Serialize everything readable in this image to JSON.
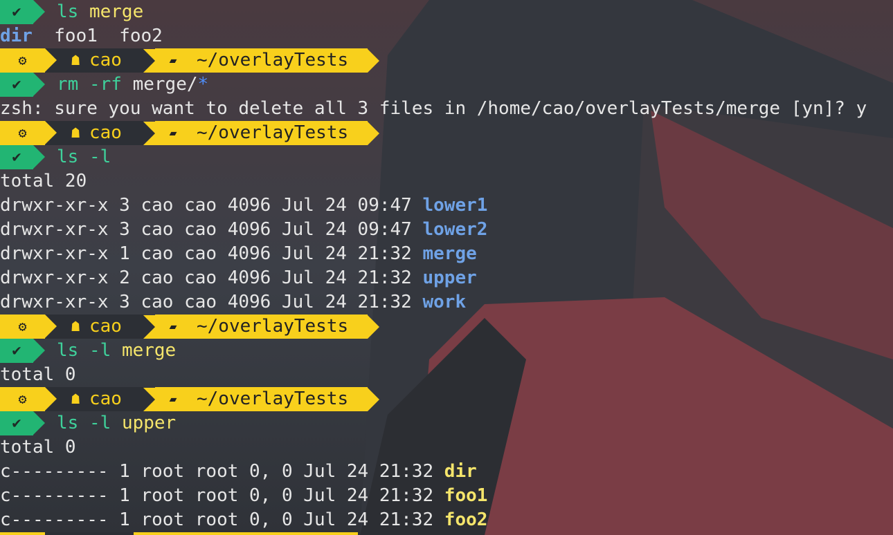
{
  "prompt": {
    "os_icon": "ubuntu-icon",
    "user_icon": "user-icon",
    "user": "cao",
    "folder_icon": "folder-icon",
    "dir": "~/overlayTests",
    "colors": {
      "accent": "#f8d01c",
      "ok": "#22b573",
      "segment_dark": "#2c2f35"
    }
  },
  "status_icon": "check-icon",
  "lines": {
    "l1": {
      "cmd": "ls",
      "arg": "merge"
    },
    "l2": {
      "items": [
        "dir",
        "foo1",
        "foo2"
      ]
    },
    "l4": {
      "cmd": "rm",
      "flag": "-rf",
      "arg": "merge/",
      "glob": "*"
    },
    "l5": {
      "text": "zsh: sure you want to delete all 3 files in /home/cao/overlayTests/merge [yn]? y"
    },
    "l7": {
      "cmd": "ls",
      "flag": "-l"
    },
    "l8": {
      "text": "total 20"
    },
    "l9": {
      "meta": "drwxr-xr-x 3 cao cao 4096 Jul 24 09:47 ",
      "name": "lower1"
    },
    "l10": {
      "meta": "drwxr-xr-x 3 cao cao 4096 Jul 24 09:47 ",
      "name": "lower2"
    },
    "l11": {
      "meta": "drwxr-xr-x 1 cao cao 4096 Jul 24 21:32 ",
      "name": "merge"
    },
    "l12": {
      "meta": "drwxr-xr-x 2 cao cao 4096 Jul 24 21:32 ",
      "name": "upper"
    },
    "l13": {
      "meta": "drwxr-xr-x 3 cao cao 4096 Jul 24 21:32 ",
      "name": "work"
    },
    "l15": {
      "cmd": "ls",
      "flag": "-l",
      "arg": "merge"
    },
    "l16": {
      "text": "total 0"
    },
    "l18": {
      "cmd": "ls",
      "flag": "-l",
      "arg": "upper"
    },
    "l19": {
      "text": "total 0"
    },
    "l20": {
      "meta": "c--------- 1 root root 0, 0 Jul 24 21:32 ",
      "name": "dir"
    },
    "l21": {
      "meta": "c--------- 1 root root 0, 0 Jul 24 21:32 ",
      "name": "foo1"
    },
    "l22": {
      "meta": "c--------- 1 root root 0, 0 Jul 24 21:32 ",
      "name": "foo2"
    }
  }
}
